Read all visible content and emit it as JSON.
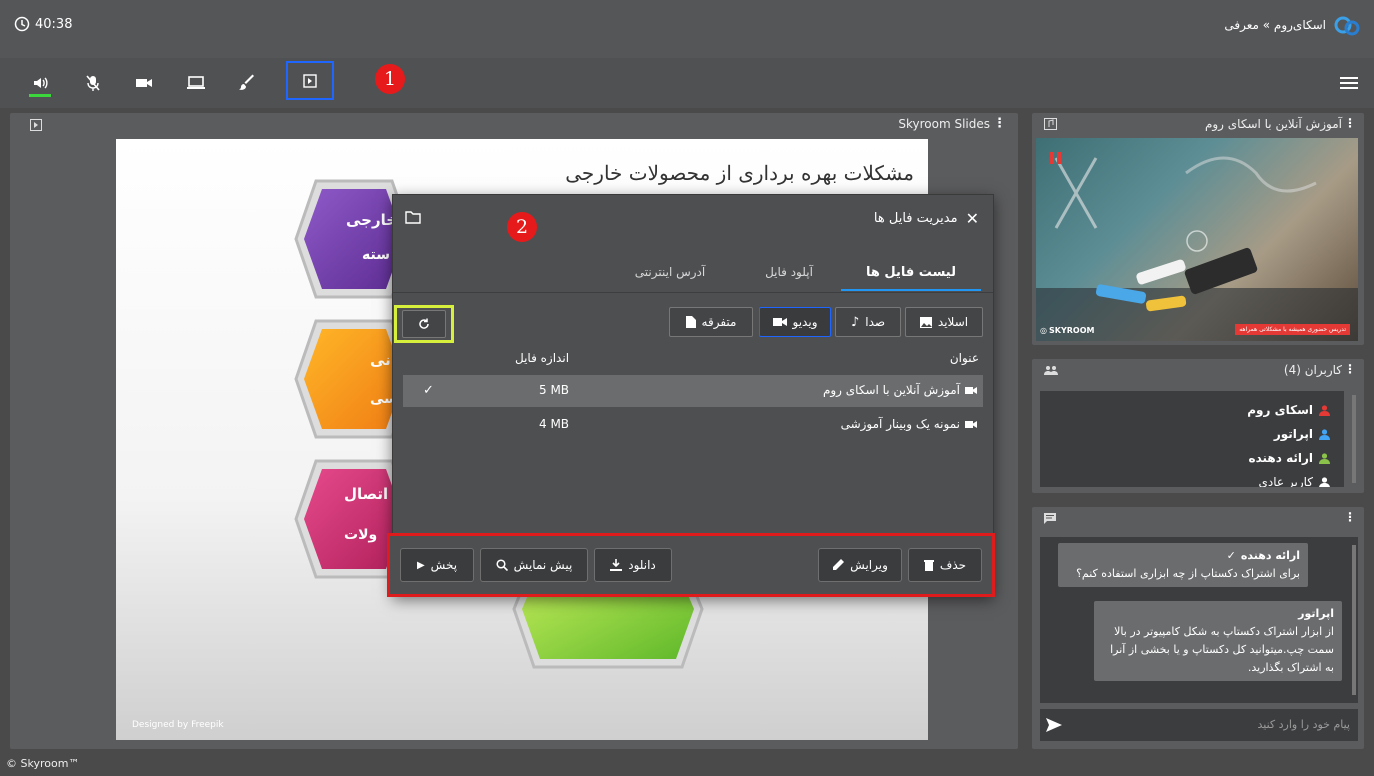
{
  "header": {
    "timer": "40:38",
    "breadcrumb": "اسکای‌روم » معرفی"
  },
  "annotations": {
    "badge1": "1",
    "badge2": "2"
  },
  "slides": {
    "title": "Skyroom Slides",
    "slide_heading": "مشکلات بهره برداری از محصولات خارجی",
    "hex1_line1": "خارجی",
    "hex1_line2": "سته",
    "hex2_line1": "بانی",
    "hex2_line2": "رسی",
    "hex3_line1": "اتصال",
    "hex3_line2": "ولات",
    "credit": "Designed by Freepik"
  },
  "dialog": {
    "title": "مدیریت فایل ها",
    "tabs": [
      "لیست فایل ها",
      "آپلود فایل",
      "آدرس اینترنتی"
    ],
    "filters": [
      "اسلاید",
      "صدا",
      "ویدیو",
      "متفرقه"
    ],
    "col_title": "عنوان",
    "col_size": "اندازه فایل",
    "files": [
      {
        "name": "آموزش آنلاین با اسکای روم",
        "size": "5 MB",
        "selected": true
      },
      {
        "name": "نمونه یک وبینار آموزشی",
        "size": "4 MB",
        "selected": false
      }
    ],
    "actions": {
      "delete": "حذف",
      "edit": "ویرایش",
      "download": "دانلود",
      "preview": "پیش نمایش",
      "play": "پخش"
    }
  },
  "video_panel": {
    "title": "آموزش آنلاین با اسکای روم",
    "logo_text": "SKYROOM",
    "banner": "تدریس حضوری همیشه با مشکلاتی همراهه"
  },
  "users_panel": {
    "title": "کاربران (4)",
    "users": [
      {
        "name": "اسکای روم",
        "color": "#e53935"
      },
      {
        "name": "اپراتور",
        "color": "#42a5f5"
      },
      {
        "name": "ارائه دهنده",
        "color": "#8bc34a"
      },
      {
        "name": "کاربر عادی",
        "color": "#ffffff"
      }
    ]
  },
  "chat": {
    "messages": [
      {
        "author": "ارائه دهنده",
        "text": "برای اشتراک دکستاپ از چه ابزاری استفاده کنم؟"
      },
      {
        "author": "اپراتور",
        "text": "از ابزار اشتراک دکستاپ به شکل کامپیوتر در بالا سمت چپ.میتوانید کل دکستاپ و یا بخشی از آنرا به اشتراک بگذارید."
      }
    ],
    "input_placeholder": "پیام خود را وارد کنید"
  },
  "footer": {
    "copyright": "© Skyroom™"
  },
  "colors": {
    "accent_blue": "#1e66ff",
    "highlight_yellow": "#d7f03c",
    "highlight_red": "#e01b1b",
    "badge_red": "#e61a1a",
    "tab_underline": "#2196f3"
  }
}
